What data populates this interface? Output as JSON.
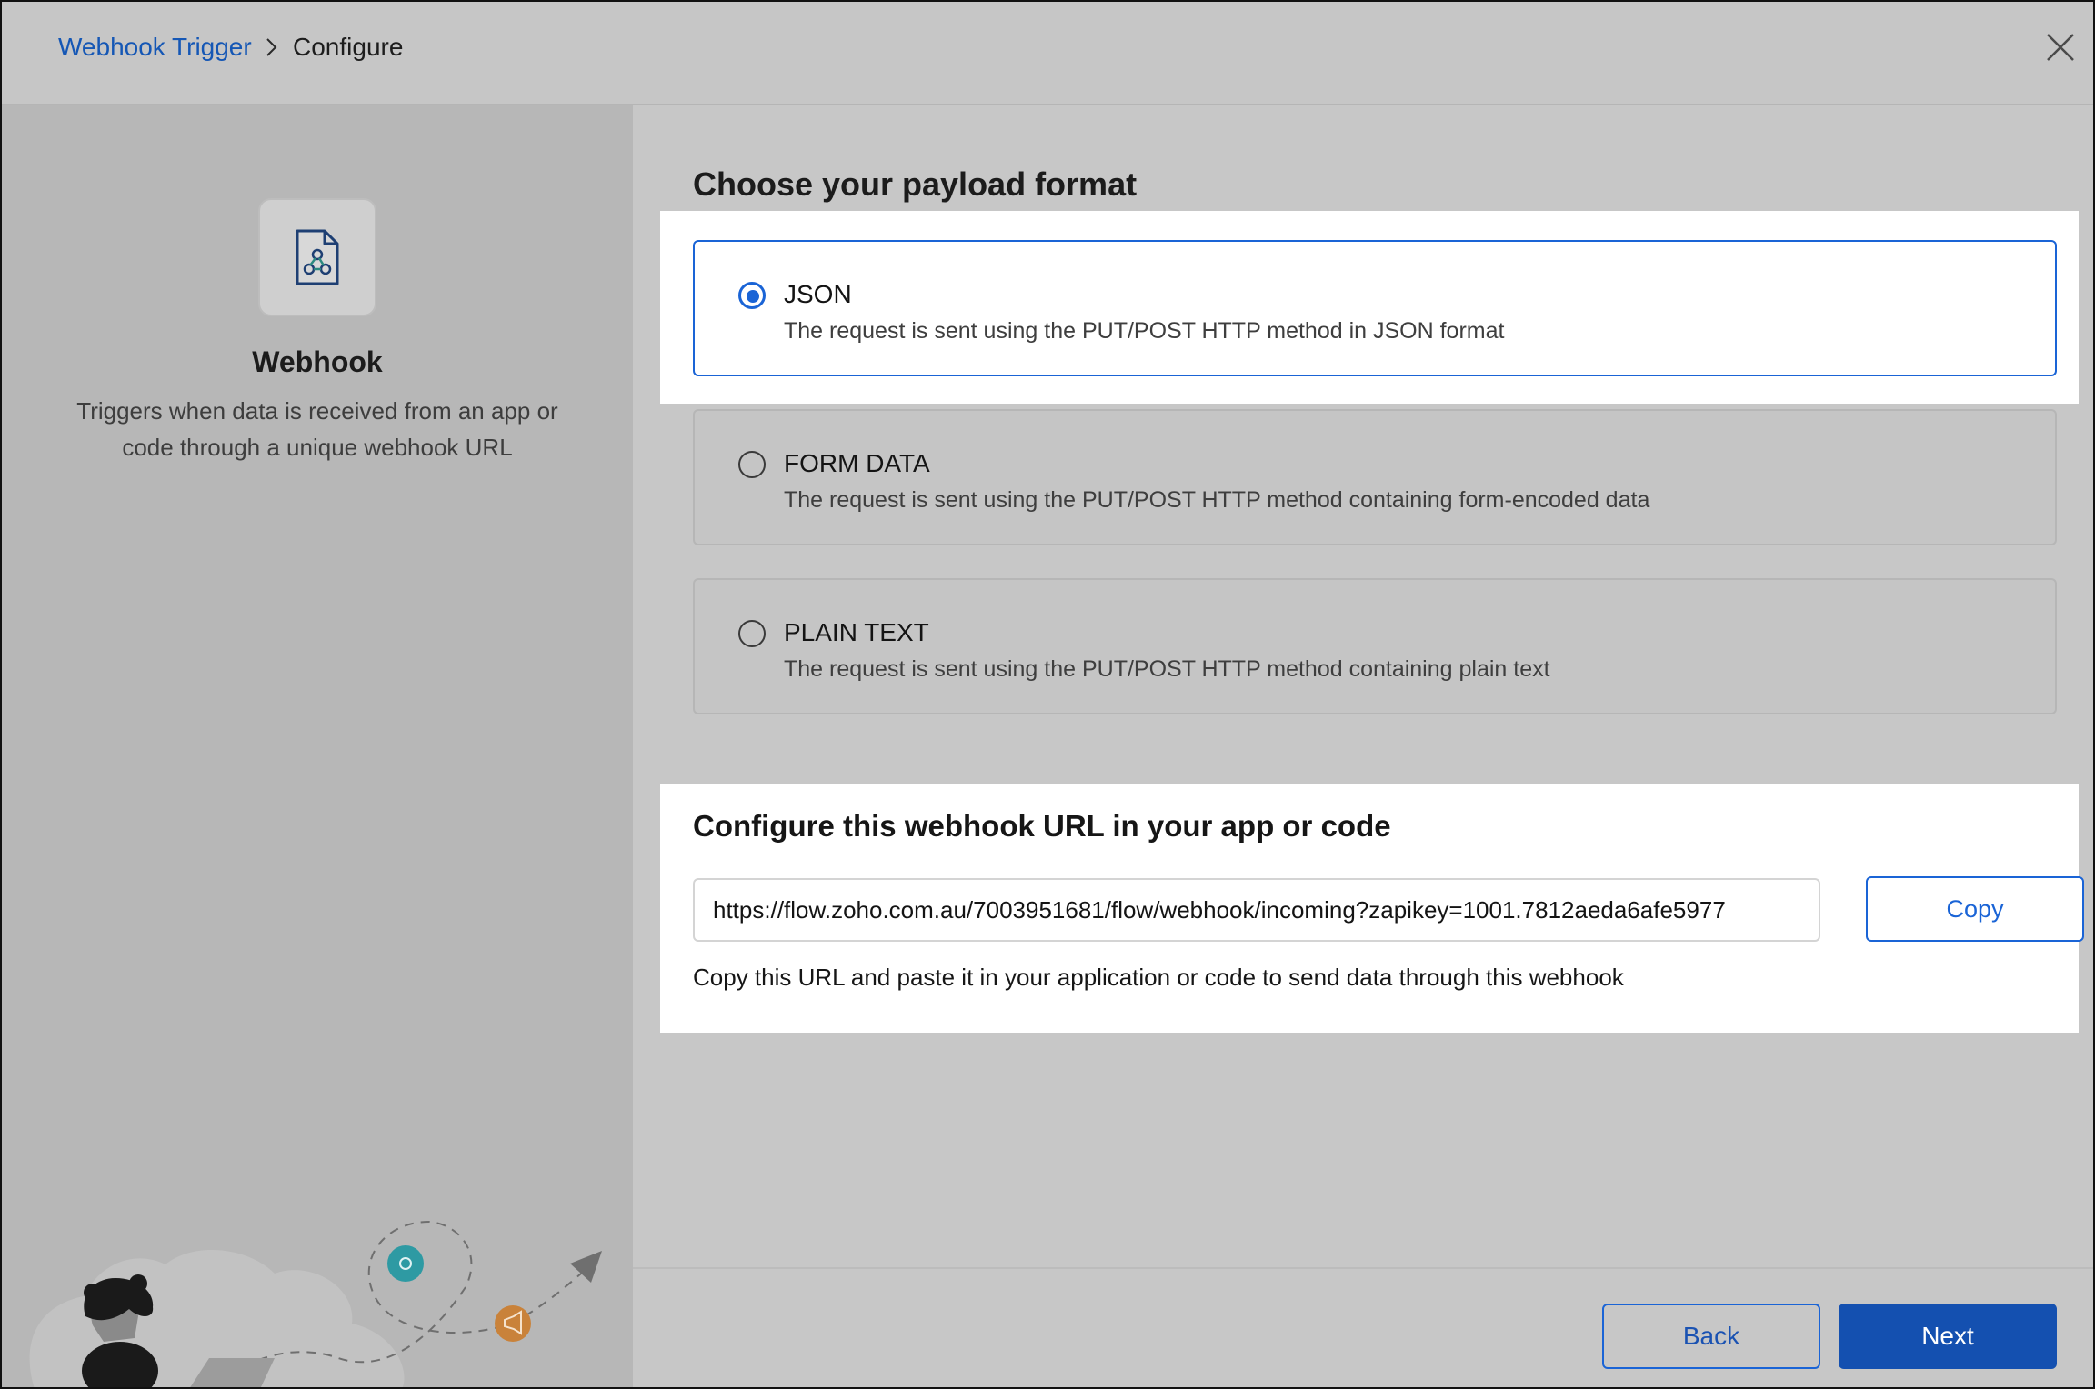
{
  "header": {
    "breadcrumb_link": "Webhook Trigger",
    "breadcrumb_current": "Configure",
    "close_icon": "close-icon"
  },
  "left_panel": {
    "icon": "webhook-icon",
    "title": "Webhook",
    "description": "Triggers when data is received from an app or code through a unique webhook URL"
  },
  "payload": {
    "title": "Choose your payload format",
    "options": [
      {
        "label": "JSON",
        "description": "The request is sent using the PUT/POST HTTP method in JSON format",
        "selected": true
      },
      {
        "label": "FORM DATA",
        "description": "The request is sent using the PUT/POST HTTP method containing form-encoded data",
        "selected": false
      },
      {
        "label": "PLAIN TEXT",
        "description": "The request is sent using the PUT/POST HTTP method containing plain text",
        "selected": false
      }
    ]
  },
  "webhook_url": {
    "title": "Configure this webhook URL in your app or code",
    "value": "https://flow.zoho.com.au/7003951681/flow/webhook/incoming?zapikey=1001.7812aeda6afe5977",
    "copy_label": "Copy",
    "help": "Copy this URL and paste it in your application or code to send data through this webhook"
  },
  "footer": {
    "back_label": "Back",
    "next_label": "Next"
  },
  "colors": {
    "accent": "#1a64d6",
    "primary_button": "#1450b0",
    "link": "#1557b5",
    "overlay": "#c7c7c7",
    "highlight": "#ffffff"
  }
}
